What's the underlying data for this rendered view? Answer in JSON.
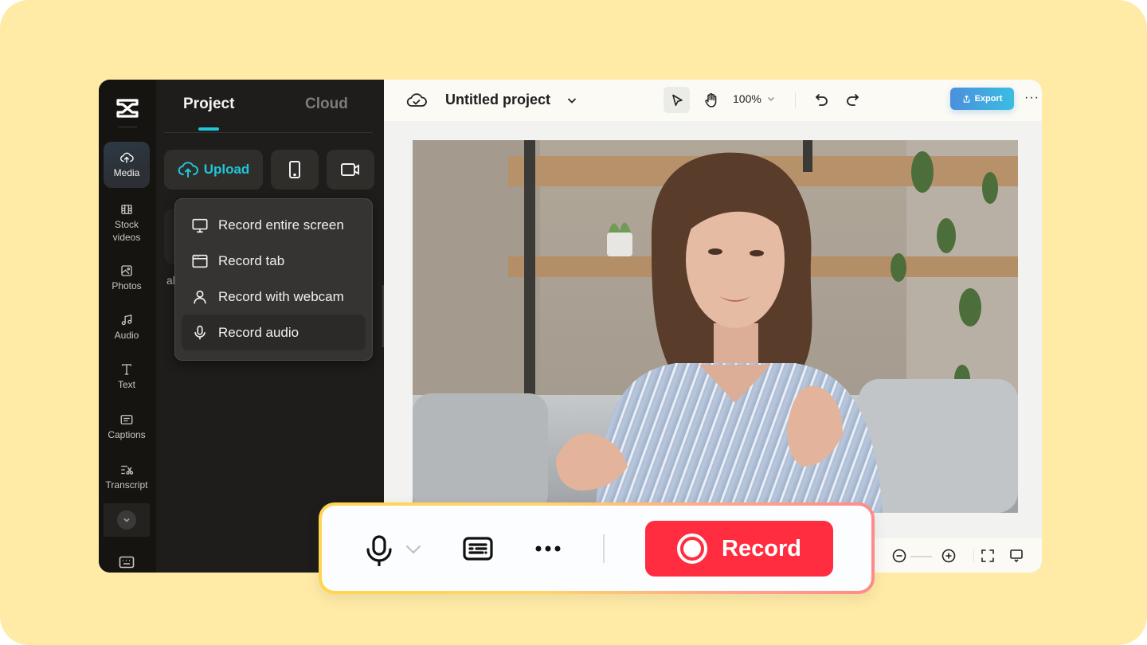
{
  "app": {
    "brand": "CapCut"
  },
  "rail": {
    "items": [
      {
        "label": "Media",
        "icon": "cloud-upload-icon",
        "active": true
      },
      {
        "label": "Stock videos",
        "icon": "film-icon"
      },
      {
        "label": "Photos",
        "icon": "image-icon"
      },
      {
        "label": "Audio",
        "icon": "music-note-icon"
      },
      {
        "label": "Text",
        "icon": "text-icon"
      },
      {
        "label": "Captions",
        "icon": "captions-icon"
      },
      {
        "label": "Transcript",
        "icon": "transcript-icon"
      }
    ],
    "more_icon": "chevron-down-icon",
    "keyboard_icon": "keyboard-icon"
  },
  "panel": {
    "tabs": [
      {
        "label": "Project",
        "active": true
      },
      {
        "label": "Cloud",
        "active": false
      }
    ],
    "upload_label": "Upload",
    "partial_text": "al",
    "record_menu": [
      {
        "label": "Record entire screen",
        "icon": "monitor-icon"
      },
      {
        "label": "Record tab",
        "icon": "browser-tab-icon"
      },
      {
        "label": "Record with webcam",
        "icon": "user-icon"
      },
      {
        "label": "Record audio",
        "icon": "microphone-icon",
        "hovered": true
      }
    ]
  },
  "topbar": {
    "project_title": "Untitled project",
    "zoom_level": "100%",
    "export_label": "Export",
    "more_label": "···"
  },
  "recorder": {
    "record_label": "Record"
  },
  "colors": {
    "accent_cyan": "#1FC6D9",
    "record_red": "#FF2D3F",
    "export_blue": "#4B8FDE",
    "background_yellow": "#FFEBA6"
  }
}
